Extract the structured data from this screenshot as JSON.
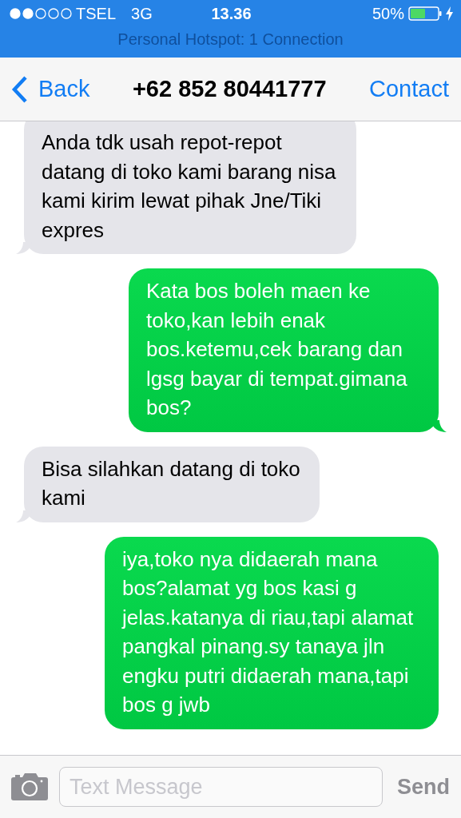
{
  "status_bar": {
    "carrier": "TSEL",
    "network": "3G",
    "time": "13.36",
    "battery": "50%",
    "hotspot": "Personal Hotspot: 1 Connection"
  },
  "nav": {
    "back": "Back",
    "title": "+62 852 80441777",
    "action": "Contact"
  },
  "messages": [
    {
      "kind": "received",
      "text": "Anda tdk usah repot-repot datang di toko kami barang nisa kami kirim lewat pihak Jne/Tiki expres"
    },
    {
      "kind": "sent",
      "text": "Kata bos boleh maen ke toko,kan lebih enak bos.ketemu,cek barang dan lgsg bayar di tempat.gimana bos?"
    },
    {
      "kind": "received",
      "text": "Bisa silahkan datang di toko kami"
    },
    {
      "kind": "sent",
      "text": "iya,toko nya didaerah mana bos?alamat yg bos kasi g jelas.katanya di riau,tapi alamat pangkal pinang.sy tanaya jln engku putri didaerah mana,tapi bos g jwb"
    }
  ],
  "composer": {
    "placeholder": "Text Message",
    "send": "Send"
  }
}
